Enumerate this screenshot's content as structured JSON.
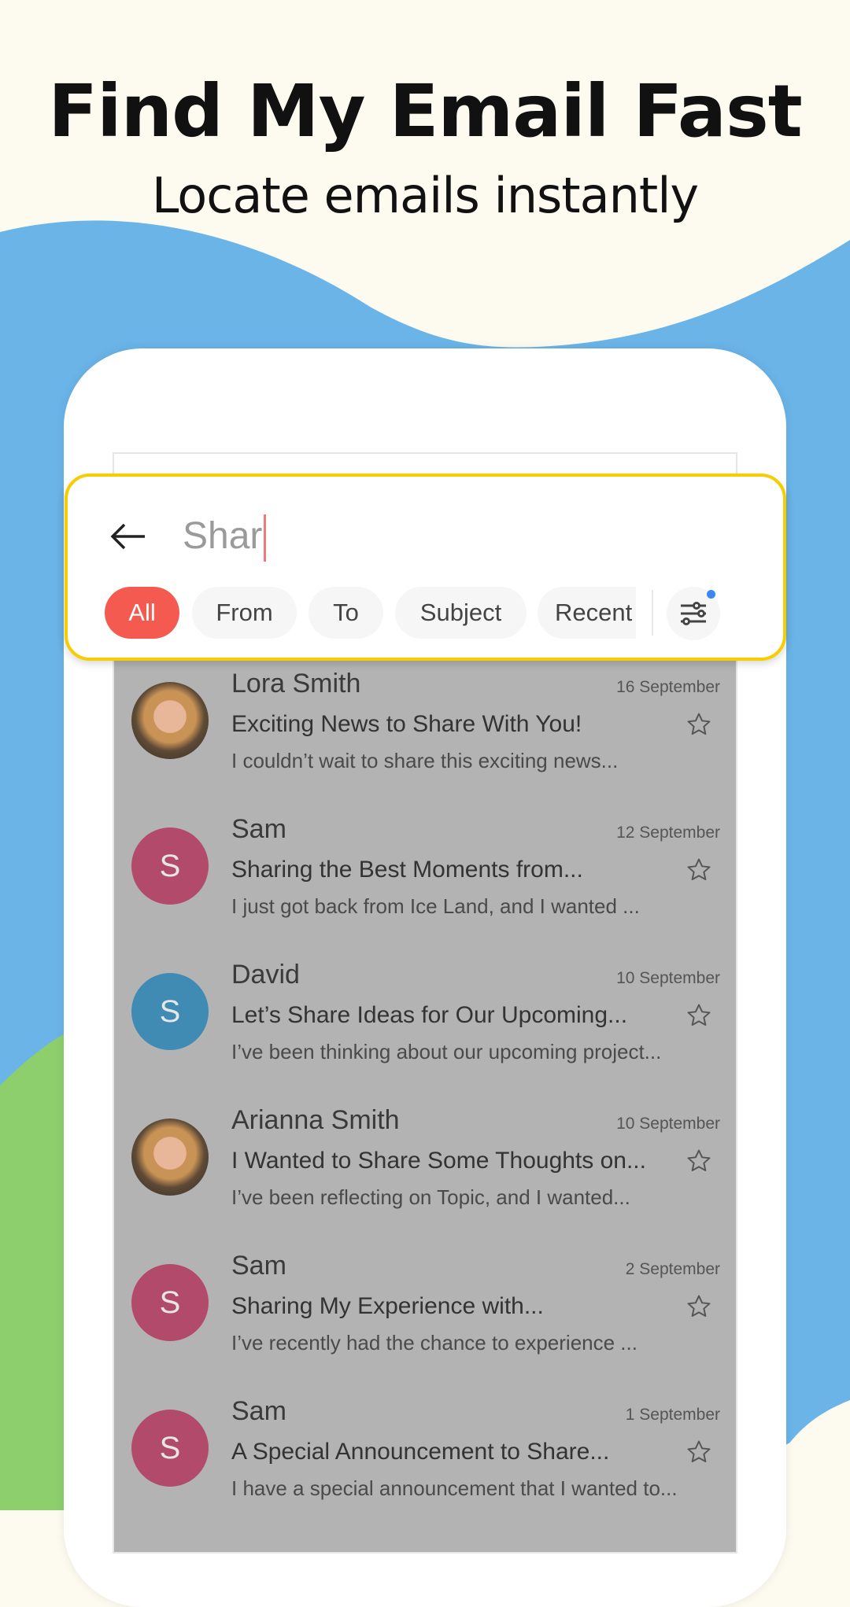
{
  "header": {
    "title": "Find My Email Fast",
    "subtitle": "Locate emails instantly"
  },
  "colors": {
    "background": "#fdfaf0",
    "wave_blue": "#6ab4e8",
    "wave_green": "#8ccf6c",
    "search_border": "#f5cd00",
    "chip_active": "#f55a50"
  },
  "search": {
    "query": "Shar",
    "back_icon": "arrow-left-icon",
    "filter_icon": "sliders-icon"
  },
  "chips": [
    {
      "label": "All",
      "active": true
    },
    {
      "label": "From"
    },
    {
      "label": "To"
    },
    {
      "label": "Subject"
    },
    {
      "label": "Recent"
    }
  ],
  "emails": [
    {
      "sender": "Lora Smith",
      "date": "16 September",
      "subject": "Exciting News to Share With You!",
      "preview": "I couldn’t wait to share this exciting news...",
      "avatar": "photo"
    },
    {
      "sender": "Sam",
      "date": "12 September",
      "subject": "Sharing the Best Moments from...",
      "preview": "I just got back from Ice Land, and I wanted ...",
      "avatar": "S",
      "color": "#b24a6c"
    },
    {
      "sender": "David",
      "date": "10 September",
      "subject": "Let’s Share Ideas for Our Upcoming...",
      "preview": "I’ve been thinking about our upcoming project...",
      "avatar": "S",
      "color": "#3f8bb3"
    },
    {
      "sender": "Arianna Smith",
      "date": "10 September",
      "subject": "I Wanted to Share Some Thoughts on...",
      "preview": "I’ve been reflecting on Topic, and I wanted...",
      "avatar": "photo"
    },
    {
      "sender": "Sam",
      "date": "2 September",
      "subject": "Sharing My Experience with...",
      "preview": "I’ve recently had the chance to experience ...",
      "avatar": "S",
      "color": "#b24a6c"
    },
    {
      "sender": "Sam",
      "date": "1 September",
      "subject": "A Special Announcement to Share...",
      "preview": "I have a special announcement that I wanted to...",
      "avatar": "S",
      "color": "#b24a6c"
    }
  ]
}
